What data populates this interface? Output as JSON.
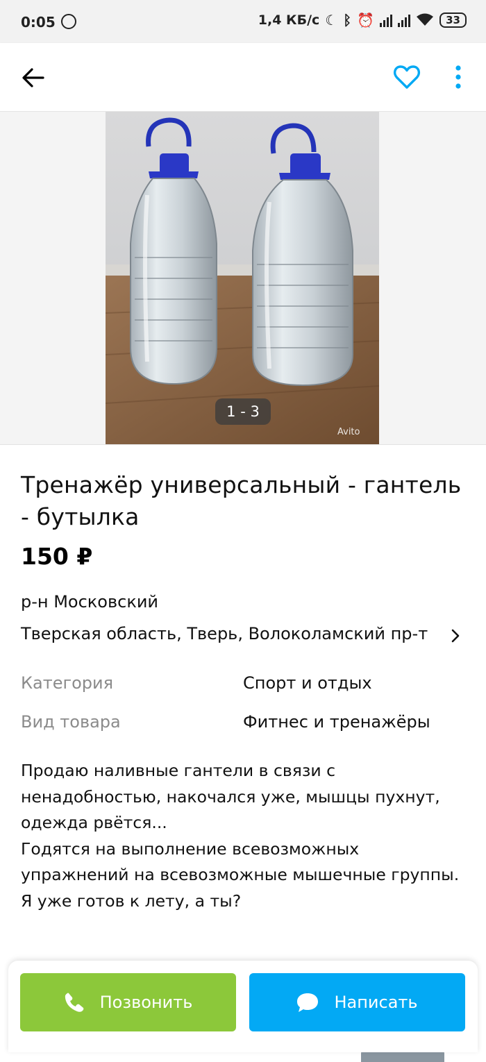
{
  "status_bar": {
    "time": "0:05",
    "speed": "1,4 КБ/с",
    "battery": "33",
    "icons": [
      "whatsapp-icon",
      "moon-icon",
      "bluetooth-icon",
      "alarm-icon",
      "signal-icon",
      "signal-icon",
      "wifi-icon",
      "battery-icon"
    ]
  },
  "toolbar": {
    "back_icon": "arrow-left-icon",
    "favorite_icon": "heart-outline-icon",
    "more_icon": "more-vertical-icon",
    "accent": "#03a9f4"
  },
  "gallery": {
    "counter": "1 - 3",
    "watermark": "Avito"
  },
  "listing": {
    "title": "Тренажёр универсальный - гантель - бутылка",
    "price": "150 ₽",
    "district": "р-н Московский",
    "address": "Тверская область, Тверь, Волоколамский пр-т"
  },
  "params": [
    {
      "label": "Категория",
      "value": "Спорт и отдых"
    },
    {
      "label": "Вид товара",
      "value": "Фитнес и тренажёры"
    }
  ],
  "description": [
    "Продаю наливные гантели в связи с ненадобностью, накочался уже, мышцы пухнут, одежда рвётся...",
    "Годятся на выполнение всевозможных упражнений на всевозможные мышечные группы.",
    "Я уже готов к лету, а ты?"
  ],
  "actions": {
    "call_label": "Позвонить",
    "write_label": "Написать",
    "call_color": "#8cc83a",
    "write_color": "#03a9f4"
  }
}
